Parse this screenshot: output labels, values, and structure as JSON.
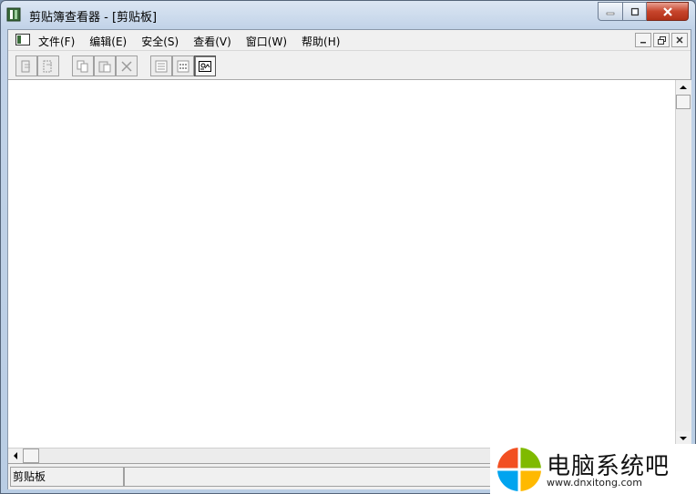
{
  "window": {
    "title": "剪贴簿查看器 - [剪贴板]"
  },
  "menubar": {
    "items": [
      {
        "label": "文件(F)"
      },
      {
        "label": "编辑(E)"
      },
      {
        "label": "安全(S)"
      },
      {
        "label": "查看(V)"
      },
      {
        "label": "窗口(W)"
      },
      {
        "label": "帮助(H)"
      }
    ]
  },
  "statusbar": {
    "pane1": "剪贴板"
  },
  "watermark": {
    "text": "电脑系统吧",
    "url": "www.dnxitong.com"
  },
  "colors": {
    "close_red": "#c7452c",
    "logo_orange": "#f25022",
    "logo_green": "#7fba00",
    "logo_blue": "#00a4ef",
    "logo_yellow": "#ffb900"
  },
  "icons": [
    "clipbook-app-icon",
    "document-icon",
    "connect-icon",
    "disconnect-icon",
    "copy-icon",
    "paste-icon",
    "delete-icon",
    "table-of-contents-icon",
    "thumbnails-icon",
    "full-page-icon"
  ]
}
